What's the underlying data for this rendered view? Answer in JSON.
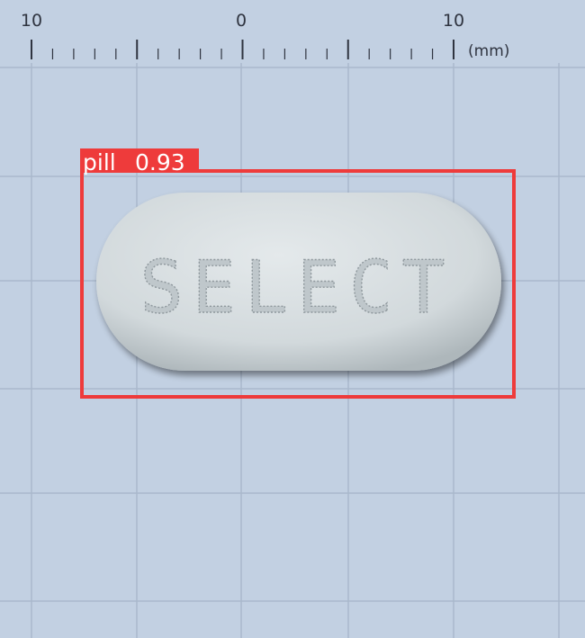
{
  "ruler": {
    "labels": [
      "10",
      "0",
      "10"
    ],
    "unit": "(mm)"
  },
  "pill": {
    "imprint": "SELECT",
    "color": "#d7dddf"
  },
  "detection": {
    "class_label": "pill",
    "confidence": "0.93",
    "box_color": "#ee3b3b"
  },
  "background": {
    "color": "#c2d0e2",
    "grid_color": "#a9b8cc"
  }
}
